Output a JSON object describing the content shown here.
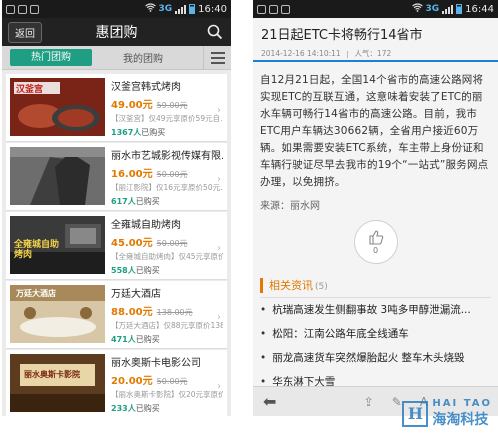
{
  "left": {
    "status": {
      "time": "16:40",
      "network": "3G"
    },
    "header": {
      "back_label": "返回",
      "title": "惠团购"
    },
    "tabs": {
      "active_label": "热门团购",
      "inactive_label": "我的团购"
    },
    "items": [
      {
        "thumb_text": "汉釜宫",
        "name": "汉釜宫韩式烤肉",
        "price": "49.00元",
        "old_price": "59.00元",
        "desc": "【汉釜宫】仅49元享原价59元自...",
        "sold_count": "1367人",
        "sold_suffix": "已购买",
        "thumb_color": "#8a2b1e"
      },
      {
        "thumb_text": "",
        "name": "丽水市艺城影视传媒有限...",
        "price": "16.00元",
        "old_price": "50.00元",
        "desc": "【丽江影院】仅16元享原价50元...",
        "sold_count": "617人",
        "sold_suffix": "已购买",
        "thumb_color": "#5a5a5a"
      },
      {
        "thumb_text": "全雍城自助烤肉",
        "name": "全雍城自助烤肉",
        "price": "45.00元",
        "old_price": "50.00元",
        "desc": "【全雍城自助烤肉】仅45元享原价...",
        "sold_count": "558人",
        "sold_suffix": "已购买",
        "thumb_color": "#2a2a2a"
      },
      {
        "thumb_text": "万廷大酒店",
        "name": "万廷大酒店",
        "price": "88.00元",
        "old_price": "138.00元",
        "desc": "【万廷大酒店】仅88元享原价138元...",
        "sold_count": "471人",
        "sold_suffix": "已购买",
        "thumb_color": "#c9b18c"
      },
      {
        "thumb_text": "丽水奥斯卡影院",
        "name": "丽水奥斯卡电影公司",
        "price": "20.00元",
        "old_price": "50.00元",
        "desc": "【丽水奥斯卡影院】仅20元享原价...",
        "sold_count": "233人",
        "sold_suffix": "已购买",
        "thumb_color": "#6b4a2a"
      }
    ]
  },
  "right": {
    "status": {
      "time": "16:44",
      "network": "3G"
    },
    "article": {
      "title": "21日起ETC卡将畅行14省市",
      "date": "2014-12-16 14:10:11",
      "views_label": "人气：172",
      "body": "自12月21日起，全国14个省市的高速公路网将实现ETC的互联互通，这意味着安装了ETC的丽水车辆可畅行14省市的高速公路。目前，我市ETC用户车辆达30662辆，全省用户接近60万辆。如果需要安装ETC系统，车主带上身份证和车辆行驶证尽早去我市的19个“一站式”服务网点办理，以免拥挤。",
      "source": "来源：丽水网",
      "likes": "0"
    },
    "related": {
      "heading": "相关资讯",
      "count": "(5)",
      "items": [
        "杭瑞高速发生侧翻事故 3吨多甲醇泄漏流...",
        "松阳：江南公路年底全线通车",
        "丽龙高速货车突然爆胎起火 整车木头烧毁",
        "华东淋下大雪"
      ]
    }
  },
  "watermark": {
    "en": "HAI TAO",
    "cn": "海淘科技",
    "logo": "H"
  }
}
